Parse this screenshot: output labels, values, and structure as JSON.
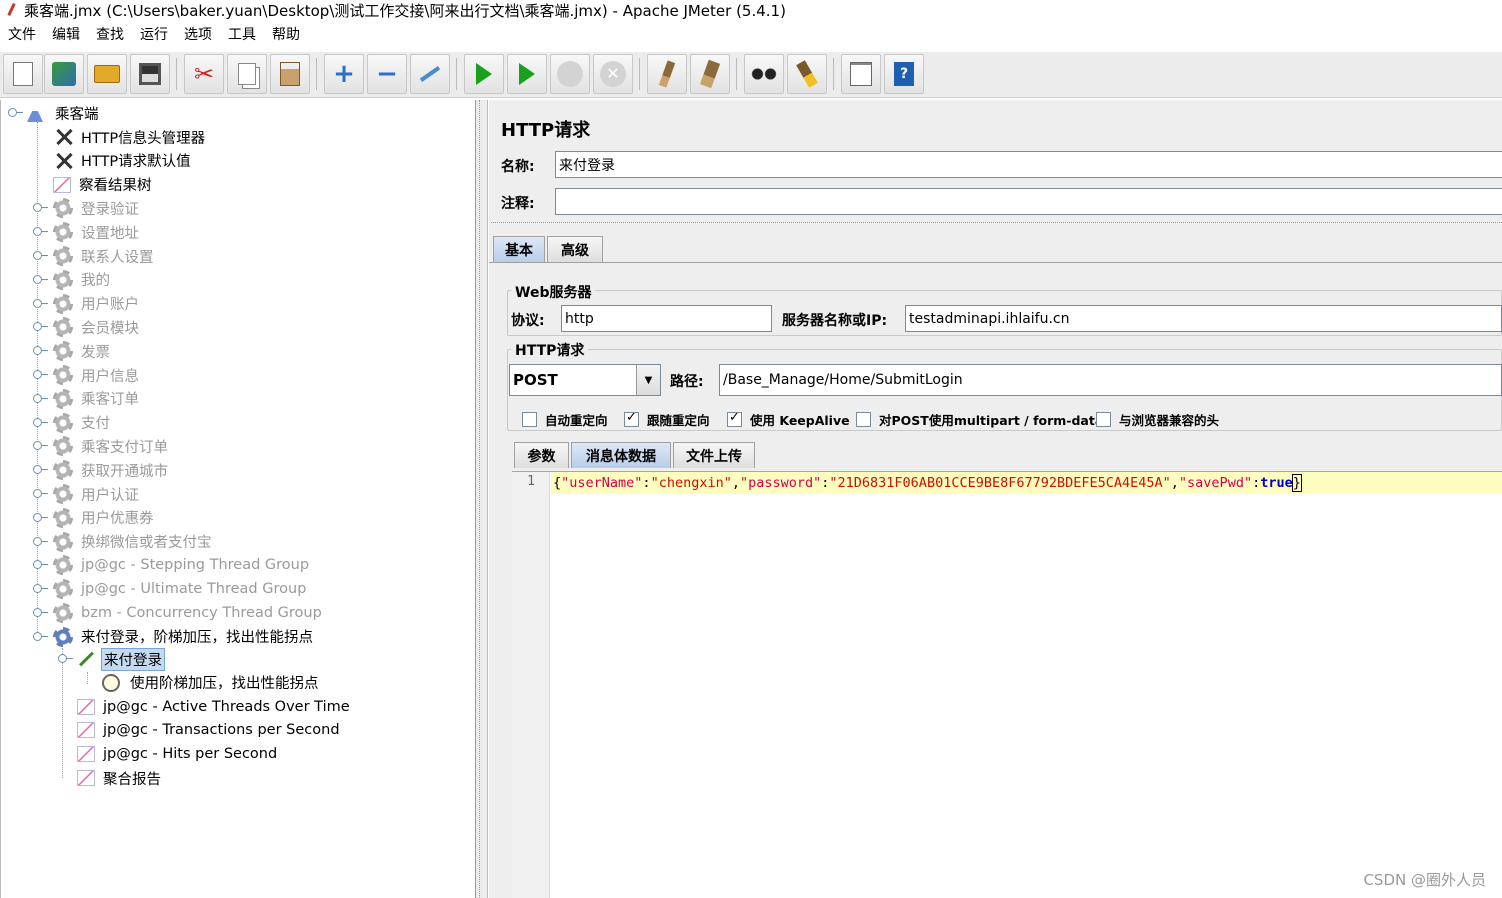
{
  "window": {
    "title": "乘客端.jmx (C:\\Users\\baker.yuan\\Desktop\\测试工作交接\\阿来出行文档\\乘客端.jmx) - Apache JMeter (5.4.1)"
  },
  "menu": [
    "文件",
    "编辑",
    "查找",
    "运行",
    "选项",
    "工具",
    "帮助"
  ],
  "toolbar": {
    "buttons": [
      "new-icon",
      "templates-icon",
      "open-icon",
      "save-icon",
      "cut-icon",
      "copy-icon",
      "paste-icon",
      "expand-icon",
      "collapse-icon",
      "toggle-icon",
      "start-icon",
      "start-no-pause-icon",
      "stop-icon",
      "shutdown-icon",
      "clear-icon",
      "clear-all-icon",
      "search-icon",
      "reset-search-icon",
      "function-helper-icon",
      "help-icon"
    ]
  },
  "tree": {
    "root": "乘客端",
    "items": [
      {
        "label": "HTTP信息头管理器",
        "icon": "tools-icon",
        "enabled": true
      },
      {
        "label": "HTTP请求默认值",
        "icon": "tools-icon",
        "enabled": true
      },
      {
        "label": "察看结果树",
        "icon": "graph-icon",
        "enabled": true
      },
      {
        "label": "登录验证",
        "icon": "gear-icon",
        "enabled": false
      },
      {
        "label": "设置地址",
        "icon": "gear-icon",
        "enabled": false
      },
      {
        "label": "联系人设置",
        "icon": "gear-icon",
        "enabled": false
      },
      {
        "label": "我的",
        "icon": "gear-icon",
        "enabled": false
      },
      {
        "label": "用户账户",
        "icon": "gear-icon",
        "enabled": false
      },
      {
        "label": "会员模块",
        "icon": "gear-icon",
        "enabled": false
      },
      {
        "label": "发票",
        "icon": "gear-icon",
        "enabled": false
      },
      {
        "label": "用户信息",
        "icon": "gear-icon",
        "enabled": false
      },
      {
        "label": "乘客订单",
        "icon": "gear-icon",
        "enabled": false
      },
      {
        "label": "支付",
        "icon": "gear-icon",
        "enabled": false
      },
      {
        "label": "乘客支付订单",
        "icon": "gear-icon",
        "enabled": false
      },
      {
        "label": "获取开通城市",
        "icon": "gear-icon",
        "enabled": false
      },
      {
        "label": "用户认证",
        "icon": "gear-icon",
        "enabled": false
      },
      {
        "label": "用户优惠券",
        "icon": "gear-icon",
        "enabled": false
      },
      {
        "label": "换绑微信或者支付宝",
        "icon": "gear-icon",
        "enabled": false
      },
      {
        "label": "jp@gc - Stepping Thread Group",
        "icon": "gear-icon",
        "enabled": false
      },
      {
        "label": "jp@gc - Ultimate Thread Group",
        "icon": "gear-icon",
        "enabled": false
      },
      {
        "label": "bzm - Concurrency Thread Group",
        "icon": "gear-icon",
        "enabled": false
      },
      {
        "label": "来付登录，阶梯加压，找出性能拐点",
        "icon": "gear-icon",
        "enabled": true
      }
    ],
    "children": [
      {
        "label": "来付登录",
        "icon": "pipette-icon",
        "selected": true
      },
      {
        "label": "使用阶梯加压，找出性能拐点",
        "icon": "timer-icon"
      },
      {
        "label": "jp@gc - Active Threads Over Time",
        "icon": "graph-icon"
      },
      {
        "label": "jp@gc - Transactions per Second",
        "icon": "graph-icon"
      },
      {
        "label": "jp@gc - Hits per Second",
        "icon": "graph-icon"
      },
      {
        "label": "聚合报告",
        "icon": "graph-icon"
      }
    ]
  },
  "panel": {
    "title": "HTTP请求",
    "name_label": "名称:",
    "name_value": "来付登录",
    "comment_label": "注释:",
    "comment_value": "",
    "tabs": [
      "基本",
      "高级"
    ],
    "web_server": {
      "title": "Web服务器",
      "protocol_label": "协议:",
      "protocol_value": "http",
      "server_label": "服务器名称或IP:",
      "server_value": "testadminapi.ihlaifu.cn"
    },
    "http_request": {
      "title": "HTTP请求",
      "method": "POST",
      "path_label": "路径:",
      "path_value": "/Base_Manage/Home/SubmitLogin"
    },
    "options": [
      {
        "label": "自动重定向",
        "checked": false
      },
      {
        "label": "跟随重定向",
        "checked": true
      },
      {
        "label": "使用 KeepAlive",
        "checked": true
      },
      {
        "label": "对POST使用multipart / form-data",
        "checked": false
      },
      {
        "label": "与浏览器兼容的头",
        "checked": false
      }
    ],
    "body_tabs": [
      "参数",
      "消息体数据",
      "文件上传"
    ],
    "body": {
      "line_no": "1",
      "k1": "\"userName\"",
      "v1": "\"chengxin\"",
      "k2": "\"password\"",
      "v2": "\"21D6831F06AB01CCE9BE8F67792BDEFE5CA4E45A\"",
      "k3": "\"savePwd\"",
      "v3": "true"
    }
  },
  "watermark": "CSDN @圈外人员"
}
